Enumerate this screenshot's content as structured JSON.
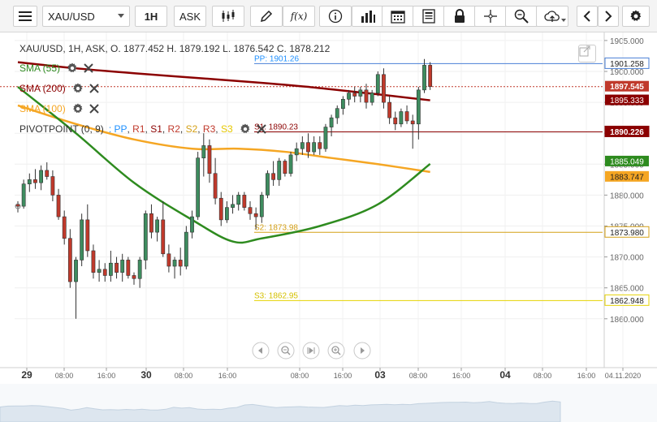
{
  "toolbar": {
    "symbol": "XAU/USD",
    "interval": "1H",
    "price_type": "ASK",
    "fx_label": "f(x)",
    "icons": [
      "menu-icon",
      "candlestick-icon",
      "pencil-icon",
      "function-icon",
      "info-icon",
      "bar-chart-icon",
      "calendar-icon",
      "document-icon",
      "lock-icon",
      "crosshair-icon",
      "zoom-icon",
      "cloud-upload-icon",
      "chevron-left-icon",
      "chevron-right-icon",
      "gear-icon"
    ]
  },
  "legend": {
    "ohlc_text": "XAU/USD, 1H, ASK,  O. 1877.452 H. 1879.192 L. 1876.542 C. 1878.212",
    "sma55": "SMA (55)",
    "sma200": "SMA (200)",
    "sma100": "SMA (100)",
    "pivot": "PIVOTPOINT (0, 9)",
    "pivot_series": [
      ": PP",
      "R1",
      "S1",
      "R2",
      "S2",
      "R3",
      "S3"
    ]
  },
  "colors": {
    "up": "#3e8c5f",
    "down": "#c0392b",
    "sma55": "#2e8b1f",
    "sma100": "#f5a623",
    "sma200": "#8b0000",
    "pp": "#4a7fd6",
    "s1": "#8b0000",
    "s2": "#d4a017",
    "s3": "#e6d200",
    "pivot_pp_text": "#1e90ff",
    "pivot_r_text": "#c0392b",
    "pivot_s2_text": "#d4a017",
    "pivot_s3_text": "#e6d200"
  },
  "levels": {
    "pp": {
      "label": "PP: 1901.26",
      "value": 1901.26,
      "tag": "1901.258"
    },
    "s1": {
      "label": "S1: 1890.23",
      "value": 1890.23,
      "tag": "1890.226"
    },
    "s2": {
      "label": "S2: 1873.98",
      "value": 1873.98,
      "tag": "1873.980"
    },
    "s3": {
      "label": "S3: 1862.95",
      "value": 1862.95,
      "tag": "1862.948"
    }
  },
  "price_tags": {
    "current": {
      "value": 1897.545,
      "text": "1897.545"
    },
    "sma200": {
      "value": 1895.333,
      "text": "1895.333"
    },
    "sma55": {
      "value": 1885.049,
      "text": "1885.049"
    },
    "sma100": {
      "value": 1883.747,
      "text": "1883.747"
    }
  },
  "price_axis": {
    "labels": [
      "1905.000",
      "1900.000",
      "1895.000",
      "1890.000",
      "1885.000",
      "1880.000",
      "1875.000",
      "1870.000",
      "1865.000",
      "1860.000"
    ],
    "values": [
      1905,
      1900,
      1895,
      1890,
      1885,
      1880,
      1875,
      1870,
      1865,
      1860
    ]
  },
  "time_axis": {
    "labels": [
      "29",
      "08:00",
      "16:00",
      "30",
      "08:00",
      "16:00",
      "08:00",
      "16:00",
      "03",
      "08:00",
      "16:00",
      "04",
      "08:00",
      "16:00",
      "04.11.2020"
    ],
    "bold": [
      true,
      false,
      false,
      true,
      false,
      false,
      false,
      false,
      true,
      false,
      false,
      true,
      false,
      false,
      false
    ]
  },
  "chart_data": {
    "type": "candlestick",
    "symbol": "XAU/USD",
    "timeframe": "1H",
    "ylim": [
      1858,
      1906
    ],
    "candles": [
      [
        1878.5,
        1879.0,
        1877.2,
        1878.2
      ],
      [
        1878.2,
        1882.5,
        1877.8,
        1881.8
      ],
      [
        1881.8,
        1883.5,
        1880.5,
        1882.5
      ],
      [
        1882.5,
        1884.2,
        1881.0,
        1882.0
      ],
      [
        1882.0,
        1884.8,
        1880.8,
        1884.0
      ],
      [
        1884.0,
        1885.3,
        1882.5,
        1883.0
      ],
      [
        1883.0,
        1884.0,
        1879.0,
        1880.0
      ],
      [
        1880.0,
        1881.0,
        1876.0,
        1876.5
      ],
      [
        1876.5,
        1877.5,
        1872.0,
        1873.0
      ],
      [
        1873.0,
        1874.5,
        1865.0,
        1866.0
      ],
      [
        1866.0,
        1870.0,
        1860.0,
        1869.5
      ],
      [
        1869.5,
        1877.0,
        1868.5,
        1876.0
      ],
      [
        1876.0,
        1878.5,
        1870.0,
        1871.0
      ],
      [
        1871.0,
        1872.0,
        1866.5,
        1867.5
      ],
      [
        1867.5,
        1869.5,
        1866.0,
        1868.0
      ],
      [
        1868.0,
        1869.0,
        1866.0,
        1867.0
      ],
      [
        1867.0,
        1871.0,
        1866.0,
        1869.0
      ],
      [
        1869.0,
        1870.0,
        1866.5,
        1867.5
      ],
      [
        1867.5,
        1870.5,
        1866.0,
        1869.5
      ],
      [
        1869.5,
        1870.0,
        1866.5,
        1867.0
      ],
      [
        1867.0,
        1867.5,
        1865.5,
        1866.5
      ],
      [
        1866.5,
        1870.0,
        1865.0,
        1869.5
      ],
      [
        1869.5,
        1877.5,
        1868.0,
        1877.0
      ],
      [
        1877.0,
        1878.5,
        1873.0,
        1874.0
      ],
      [
        1874.0,
        1876.5,
        1872.5,
        1876.0
      ],
      [
        1876.0,
        1879.0,
        1870.0,
        1870.5
      ],
      [
        1870.5,
        1872.0,
        1867.5,
        1868.5
      ],
      [
        1868.5,
        1870.0,
        1866.5,
        1869.5
      ],
      [
        1869.5,
        1871.5,
        1867.0,
        1868.5
      ],
      [
        1868.5,
        1875.0,
        1868.0,
        1874.0
      ],
      [
        1874.0,
        1877.5,
        1873.0,
        1876.5
      ],
      [
        1876.5,
        1887.0,
        1876.0,
        1886.0
      ],
      [
        1886.0,
        1890.0,
        1883.0,
        1888.0
      ],
      [
        1888.0,
        1889.0,
        1882.0,
        1883.5
      ],
      [
        1883.5,
        1886.0,
        1878.5,
        1879.5
      ],
      [
        1879.5,
        1880.5,
        1875.0,
        1876.0
      ],
      [
        1876.0,
        1879.0,
        1875.5,
        1878.0
      ],
      [
        1878.0,
        1880.0,
        1877.0,
        1878.5
      ],
      [
        1878.5,
        1880.5,
        1877.5,
        1880.0
      ],
      [
        1880.0,
        1880.5,
        1877.5,
        1878.0
      ],
      [
        1878.0,
        1879.0,
        1876.0,
        1877.0
      ],
      [
        1877.0,
        1878.0,
        1874.5,
        1876.5
      ],
      [
        1876.5,
        1880.5,
        1875.5,
        1880.0
      ],
      [
        1880.0,
        1884.0,
        1879.5,
        1883.5
      ],
      [
        1883.5,
        1885.5,
        1881.5,
        1882.5
      ],
      [
        1882.5,
        1886.0,
        1881.5,
        1885.5
      ],
      [
        1885.5,
        1885.8,
        1883.0,
        1883.5
      ],
      [
        1883.5,
        1887.0,
        1883.0,
        1886.5
      ],
      [
        1886.5,
        1888.5,
        1885.5,
        1887.5
      ],
      [
        1887.5,
        1889.5,
        1886.5,
        1888.5
      ],
      [
        1888.5,
        1890.0,
        1886.0,
        1887.0
      ],
      [
        1887.0,
        1889.5,
        1886.5,
        1888.5
      ],
      [
        1888.5,
        1889.5,
        1886.5,
        1887.5
      ],
      [
        1887.5,
        1891.5,
        1887.0,
        1891.0
      ],
      [
        1891.0,
        1893.0,
        1889.5,
        1892.5
      ],
      [
        1892.5,
        1894.5,
        1891.5,
        1894.0
      ],
      [
        1894.0,
        1896.0,
        1893.0,
        1895.5
      ],
      [
        1895.5,
        1897.0,
        1894.5,
        1896.5
      ],
      [
        1896.5,
        1897.5,
        1895.0,
        1896.0
      ],
      [
        1896.0,
        1897.5,
        1895.0,
        1897.0
      ],
      [
        1897.0,
        1898.0,
        1894.0,
        1895.0
      ],
      [
        1895.0,
        1897.0,
        1894.5,
        1896.5
      ],
      [
        1896.5,
        1900.0,
        1896.0,
        1899.5
      ],
      [
        1899.5,
        1900.5,
        1894.0,
        1895.0
      ],
      [
        1895.0,
        1896.0,
        1891.5,
        1892.5
      ],
      [
        1892.5,
        1893.5,
        1890.5,
        1891.5
      ],
      [
        1891.5,
        1894.0,
        1891.0,
        1893.5
      ],
      [
        1893.5,
        1894.5,
        1891.5,
        1892.0
      ],
      [
        1892.0,
        1893.0,
        1887.5,
        1891.5
      ],
      [
        1891.5,
        1897.5,
        1889.0,
        1897.0
      ],
      [
        1897.0,
        1902.0,
        1896.5,
        1901.0
      ],
      [
        1901.0,
        1901.5,
        1897.0,
        1897.545
      ]
    ],
    "sma55": [
      [
        0,
        1897.5
      ],
      [
        10,
        1890.0
      ],
      [
        20,
        1882.0
      ],
      [
        30,
        1876.0
      ],
      [
        37,
        1872.5
      ],
      [
        42,
        1873.0
      ],
      [
        52,
        1875.0
      ],
      [
        62,
        1878.5
      ],
      [
        71,
        1885.049
      ]
    ],
    "sma100": [
      [
        0,
        1894.5
      ],
      [
        10,
        1891.5
      ],
      [
        20,
        1889.0
      ],
      [
        30,
        1887.5
      ],
      [
        38,
        1887.5
      ],
      [
        46,
        1887.0
      ],
      [
        54,
        1886.0
      ],
      [
        62,
        1885.0
      ],
      [
        71,
        1883.747
      ]
    ],
    "sma200": [
      [
        0,
        1901.5
      ],
      [
        10,
        1900.5
      ],
      [
        20,
        1899.7
      ],
      [
        30,
        1899.0
      ],
      [
        40,
        1898.3
      ],
      [
        50,
        1897.5
      ],
      [
        60,
        1896.5
      ],
      [
        71,
        1895.333
      ]
    ]
  }
}
